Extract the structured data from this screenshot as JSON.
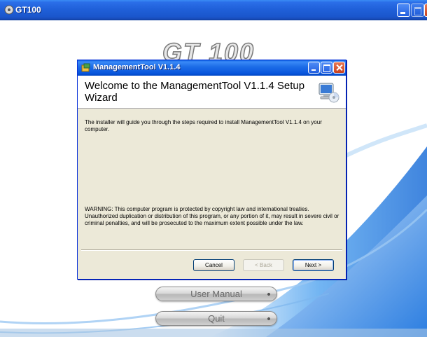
{
  "outer_window": {
    "title": "GT100",
    "logo_text": "GT 100",
    "buttons": {
      "user_manual": "User Manual",
      "quit": "Quit"
    }
  },
  "dialog": {
    "title": "ManagementTool V1.1.4",
    "heading": "Welcome to the ManagementTool V1.1.4 Setup Wizard",
    "body_text": "The installer will guide you through the steps required to install ManagementTool V1.1.4 on your computer.",
    "warning_text": "WARNING: This computer program is protected by copyright law and international treaties. Unauthorized duplication or distribution of this program, or any portion of it, may result in severe civil or criminal penalties, and will be prosecuted to the maximum extent possible under the law.",
    "buttons": {
      "cancel": "Cancel",
      "back": "< Back",
      "next": "Next >"
    }
  },
  "colors": {
    "titlebar_blue": "#1f5fd8",
    "dialog_bg": "#ece9d8",
    "swoosh_blue": "#2a7de1"
  }
}
